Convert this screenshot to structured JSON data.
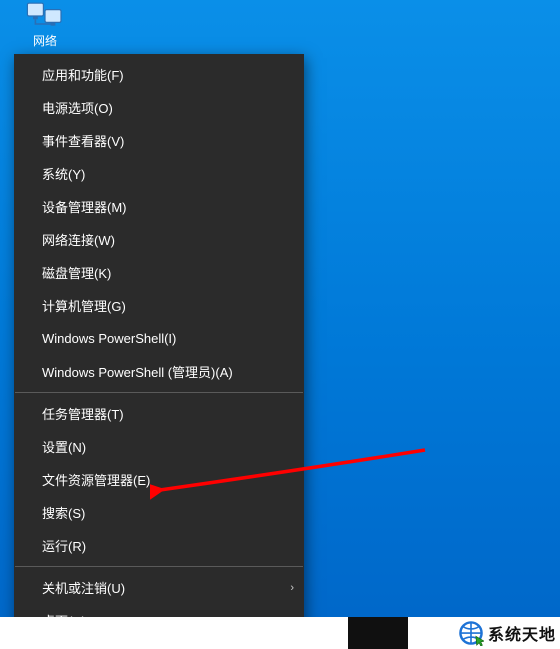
{
  "desktop_icon": {
    "label": "网络"
  },
  "menu": {
    "groups": [
      [
        {
          "label": "应用和功能(F)",
          "submenu": false
        },
        {
          "label": "电源选项(O)",
          "submenu": false
        },
        {
          "label": "事件查看器(V)",
          "submenu": false
        },
        {
          "label": "系统(Y)",
          "submenu": false
        },
        {
          "label": "设备管理器(M)",
          "submenu": false
        },
        {
          "label": "网络连接(W)",
          "submenu": false
        },
        {
          "label": "磁盘管理(K)",
          "submenu": false
        },
        {
          "label": "计算机管理(G)",
          "submenu": false
        },
        {
          "label": "Windows PowerShell(I)",
          "submenu": false
        },
        {
          "label": "Windows PowerShell (管理员)(A)",
          "submenu": false
        }
      ],
      [
        {
          "label": "任务管理器(T)",
          "submenu": false
        },
        {
          "label": "设置(N)",
          "submenu": false
        },
        {
          "label": "文件资源管理器(E)",
          "submenu": false
        },
        {
          "label": "搜索(S)",
          "submenu": false
        },
        {
          "label": "运行(R)",
          "submenu": false
        }
      ],
      [
        {
          "label": "关机或注销(U)",
          "submenu": true
        },
        {
          "label": "桌面(D)",
          "submenu": false
        }
      ]
    ]
  },
  "watermark": {
    "text": "系统天地"
  }
}
